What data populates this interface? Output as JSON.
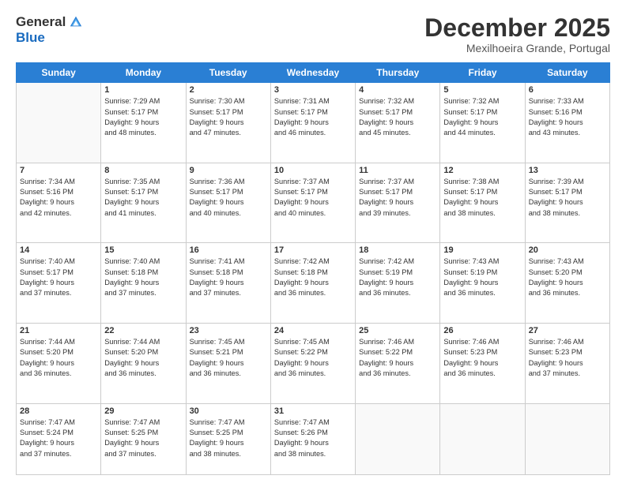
{
  "logo": {
    "general": "General",
    "blue": "Blue"
  },
  "header": {
    "month": "December 2025",
    "location": "Mexilhoeira Grande, Portugal"
  },
  "days": [
    "Sunday",
    "Monday",
    "Tuesday",
    "Wednesday",
    "Thursday",
    "Friday",
    "Saturday"
  ],
  "weeks": [
    [
      {
        "day": "",
        "content": ""
      },
      {
        "day": "1",
        "content": "Sunrise: 7:29 AM\nSunset: 5:17 PM\nDaylight: 9 hours\nand 48 minutes."
      },
      {
        "day": "2",
        "content": "Sunrise: 7:30 AM\nSunset: 5:17 PM\nDaylight: 9 hours\nand 47 minutes."
      },
      {
        "day": "3",
        "content": "Sunrise: 7:31 AM\nSunset: 5:17 PM\nDaylight: 9 hours\nand 46 minutes."
      },
      {
        "day": "4",
        "content": "Sunrise: 7:32 AM\nSunset: 5:17 PM\nDaylight: 9 hours\nand 45 minutes."
      },
      {
        "day": "5",
        "content": "Sunrise: 7:32 AM\nSunset: 5:17 PM\nDaylight: 9 hours\nand 44 minutes."
      },
      {
        "day": "6",
        "content": "Sunrise: 7:33 AM\nSunset: 5:16 PM\nDaylight: 9 hours\nand 43 minutes."
      }
    ],
    [
      {
        "day": "7",
        "content": "Sunrise: 7:34 AM\nSunset: 5:16 PM\nDaylight: 9 hours\nand 42 minutes."
      },
      {
        "day": "8",
        "content": "Sunrise: 7:35 AM\nSunset: 5:17 PM\nDaylight: 9 hours\nand 41 minutes."
      },
      {
        "day": "9",
        "content": "Sunrise: 7:36 AM\nSunset: 5:17 PM\nDaylight: 9 hours\nand 40 minutes."
      },
      {
        "day": "10",
        "content": "Sunrise: 7:37 AM\nSunset: 5:17 PM\nDaylight: 9 hours\nand 40 minutes."
      },
      {
        "day": "11",
        "content": "Sunrise: 7:37 AM\nSunset: 5:17 PM\nDaylight: 9 hours\nand 39 minutes."
      },
      {
        "day": "12",
        "content": "Sunrise: 7:38 AM\nSunset: 5:17 PM\nDaylight: 9 hours\nand 38 minutes."
      },
      {
        "day": "13",
        "content": "Sunrise: 7:39 AM\nSunset: 5:17 PM\nDaylight: 9 hours\nand 38 minutes."
      }
    ],
    [
      {
        "day": "14",
        "content": "Sunrise: 7:40 AM\nSunset: 5:17 PM\nDaylight: 9 hours\nand 37 minutes."
      },
      {
        "day": "15",
        "content": "Sunrise: 7:40 AM\nSunset: 5:18 PM\nDaylight: 9 hours\nand 37 minutes."
      },
      {
        "day": "16",
        "content": "Sunrise: 7:41 AM\nSunset: 5:18 PM\nDaylight: 9 hours\nand 37 minutes."
      },
      {
        "day": "17",
        "content": "Sunrise: 7:42 AM\nSunset: 5:18 PM\nDaylight: 9 hours\nand 36 minutes."
      },
      {
        "day": "18",
        "content": "Sunrise: 7:42 AM\nSunset: 5:19 PM\nDaylight: 9 hours\nand 36 minutes."
      },
      {
        "day": "19",
        "content": "Sunrise: 7:43 AM\nSunset: 5:19 PM\nDaylight: 9 hours\nand 36 minutes."
      },
      {
        "day": "20",
        "content": "Sunrise: 7:43 AM\nSunset: 5:20 PM\nDaylight: 9 hours\nand 36 minutes."
      }
    ],
    [
      {
        "day": "21",
        "content": "Sunrise: 7:44 AM\nSunset: 5:20 PM\nDaylight: 9 hours\nand 36 minutes."
      },
      {
        "day": "22",
        "content": "Sunrise: 7:44 AM\nSunset: 5:20 PM\nDaylight: 9 hours\nand 36 minutes."
      },
      {
        "day": "23",
        "content": "Sunrise: 7:45 AM\nSunset: 5:21 PM\nDaylight: 9 hours\nand 36 minutes."
      },
      {
        "day": "24",
        "content": "Sunrise: 7:45 AM\nSunset: 5:22 PM\nDaylight: 9 hours\nand 36 minutes."
      },
      {
        "day": "25",
        "content": "Sunrise: 7:46 AM\nSunset: 5:22 PM\nDaylight: 9 hours\nand 36 minutes."
      },
      {
        "day": "26",
        "content": "Sunrise: 7:46 AM\nSunset: 5:23 PM\nDaylight: 9 hours\nand 36 minutes."
      },
      {
        "day": "27",
        "content": "Sunrise: 7:46 AM\nSunset: 5:23 PM\nDaylight: 9 hours\nand 37 minutes."
      }
    ],
    [
      {
        "day": "28",
        "content": "Sunrise: 7:47 AM\nSunset: 5:24 PM\nDaylight: 9 hours\nand 37 minutes."
      },
      {
        "day": "29",
        "content": "Sunrise: 7:47 AM\nSunset: 5:25 PM\nDaylight: 9 hours\nand 37 minutes."
      },
      {
        "day": "30",
        "content": "Sunrise: 7:47 AM\nSunset: 5:25 PM\nDaylight: 9 hours\nand 38 minutes."
      },
      {
        "day": "31",
        "content": "Sunrise: 7:47 AM\nSunset: 5:26 PM\nDaylight: 9 hours\nand 38 minutes."
      },
      {
        "day": "",
        "content": ""
      },
      {
        "day": "",
        "content": ""
      },
      {
        "day": "",
        "content": ""
      }
    ]
  ]
}
